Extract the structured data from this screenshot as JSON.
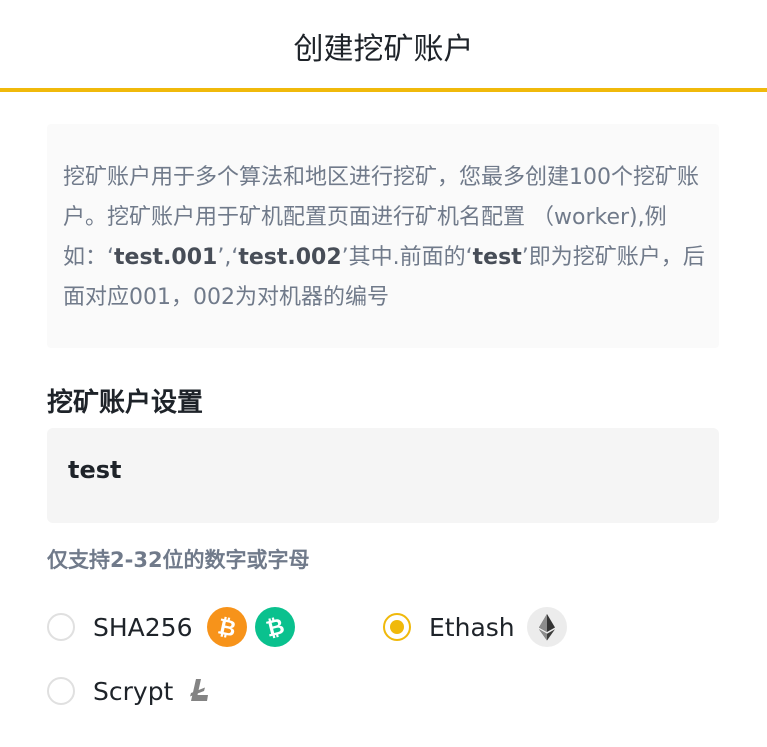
{
  "header": {
    "title": "创建挖矿账户"
  },
  "info": {
    "segments": [
      {
        "text": "挖矿账户用于多个算法和地区进行挖矿，您最多创建100个挖矿账户。挖矿账户用于矿机配置页面进行矿机名配置 （worker),例如：‘",
        "bold": false
      },
      {
        "text": "test.001",
        "bold": true
      },
      {
        "text": "’,‘",
        "bold": false
      },
      {
        "text": "test.002",
        "bold": true
      },
      {
        "text": "’其中.前面的‘",
        "bold": false
      },
      {
        "text": "test",
        "bold": true
      },
      {
        "text": "’即为挖矿账户，后面对应001，002为对机器的编号",
        "bold": false
      }
    ]
  },
  "account": {
    "label": "挖矿账户设置",
    "value": "test",
    "hint": "仅支持2-32位的数字或字母"
  },
  "algorithms": [
    {
      "label": "SHA256",
      "checked": false,
      "coins": [
        "bitcoin-icon",
        "bitcoin-cash-icon"
      ]
    },
    {
      "label": "Ethash",
      "checked": true,
      "coins": [
        "ethereum-icon"
      ]
    },
    {
      "label": "Scrypt",
      "checked": false,
      "coins": [
        "litecoin-icon"
      ]
    }
  ],
  "colors": {
    "accent": "#f0b90b",
    "bitcoin": "#f7931a",
    "bitcoin_cash": "#0ac18e",
    "ethereum_bg": "#ececec",
    "litecoin": "#838383"
  }
}
